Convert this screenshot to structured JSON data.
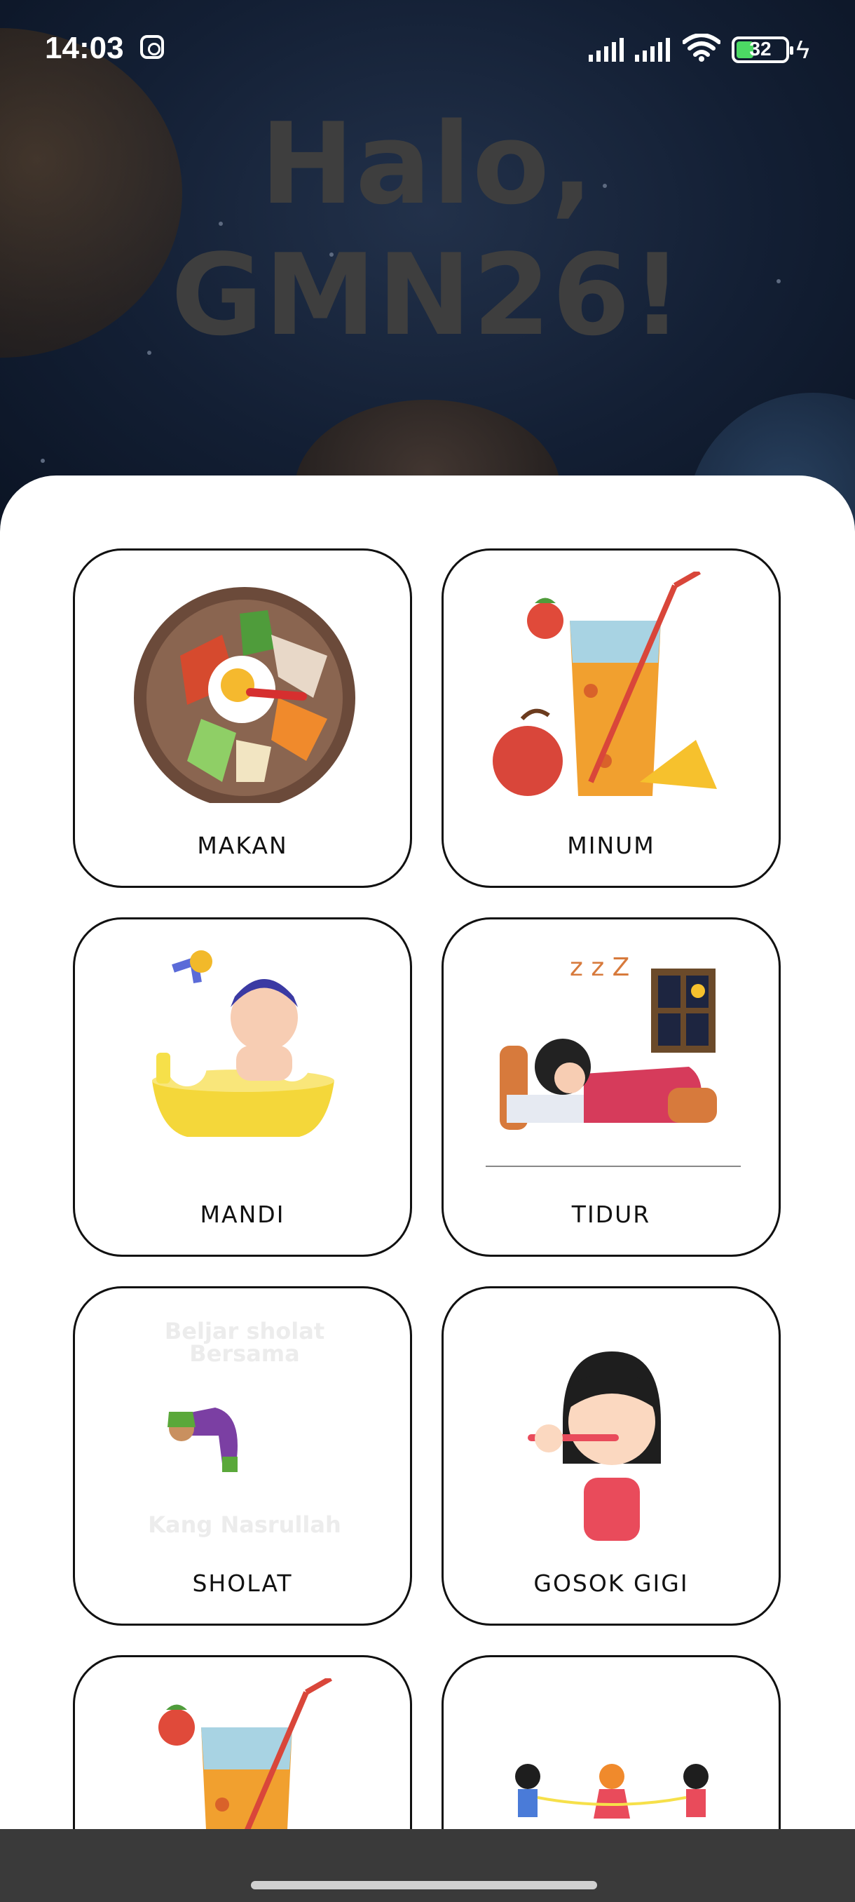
{
  "status_bar": {
    "time": "14:03",
    "battery": "32"
  },
  "header": {
    "greeting": "Halo, GMN26!"
  },
  "activities": [
    {
      "label": "MAKAN",
      "icon": "food-bowl-icon"
    },
    {
      "label": "MINUM",
      "icon": "drink-icon"
    },
    {
      "label": "MANDI",
      "icon": "bath-icon"
    },
    {
      "label": "TIDUR",
      "icon": "sleep-icon"
    },
    {
      "label": "SHOLAT",
      "icon": "prayer-icon"
    },
    {
      "label": "GOSOK GIGI",
      "icon": "brush-teeth-icon"
    },
    {
      "label": "",
      "icon": "drink-icon"
    },
    {
      "label": "",
      "icon": "kids-playing-icon"
    }
  ],
  "sholat_watermark": {
    "line1": "Beljar sholat",
    "line2": "Bersama",
    "line3": "Kang Nasrullah"
  }
}
